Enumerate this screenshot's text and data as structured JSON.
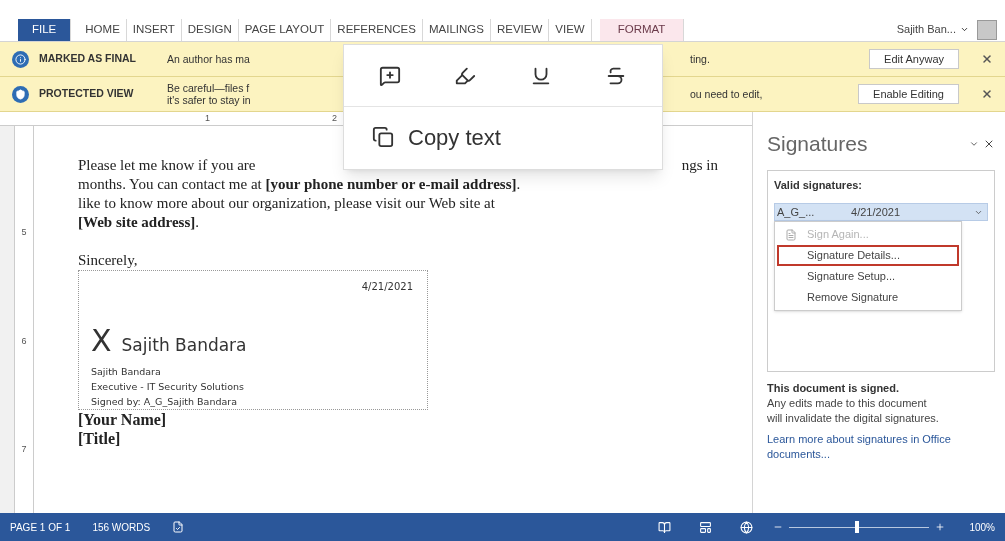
{
  "ribbon_tabs": [
    {
      "label": "FILE",
      "kind": "file",
      "selected": false
    },
    {
      "label": "HOME",
      "kind": "tab",
      "selected": false
    },
    {
      "label": "INSERT",
      "kind": "tab",
      "selected": false
    },
    {
      "label": "DESIGN",
      "kind": "tab",
      "selected": false
    },
    {
      "label": "PAGE LAYOUT",
      "kind": "tab",
      "selected": false
    },
    {
      "label": "REFERENCES",
      "kind": "tab",
      "selected": false
    },
    {
      "label": "MAILINGS",
      "kind": "tab",
      "selected": false
    },
    {
      "label": "REVIEW",
      "kind": "tab",
      "selected": false
    },
    {
      "label": "VIEW",
      "kind": "tab",
      "selected": false
    },
    {
      "label": "FORMAT",
      "kind": "contextual",
      "selected": false
    }
  ],
  "user": {
    "name": "Sajith Ban..."
  },
  "message_bars": [
    {
      "kind": "info",
      "title": "MARKED AS FINAL",
      "left_lines": [
        "An author has ma"
      ],
      "right_lines": [
        "ting."
      ],
      "button": "Edit Anyway"
    },
    {
      "kind": "shield",
      "title": "PROTECTED VIEW",
      "left_lines": [
        "Be careful—files f",
        "it's safer to stay in"
      ],
      "right_lines": [
        "ou need to edit,"
      ],
      "button": "Enable Editing"
    }
  ],
  "popup": {
    "action": "Copy text"
  },
  "ruler": {
    "marks": [
      "1",
      "2"
    ],
    "side_marks": [
      "5",
      "6",
      "7"
    ]
  },
  "document": {
    "first_line_left": "Please let me know if you are",
    "first_line_right": "ngs in",
    "lines": [
      "months. You can contact me at **[your phone number or e-mail address]**.",
      "like to know more about our organization, please visit our Web site at",
      "**[Web site address]**."
    ],
    "closing": "Sincerely,",
    "signature": {
      "date": "4/21/2021",
      "mark": "X",
      "name": "Sajith Bandara",
      "details": [
        "Sajith Bandara",
        "Executive - IT Security Solutions",
        "Signed by: A_G_Sajith Bandara"
      ]
    },
    "after": [
      "[Your Name]",
      "[Title]"
    ]
  },
  "pane": {
    "title": "Signatures",
    "section": "Valid signatures:",
    "signature": {
      "name": "A_G_...",
      "date": "4/21/2021"
    },
    "menu": [
      {
        "label": "Sign Again...",
        "disabled": true,
        "selected": false
      },
      {
        "label": "Signature Details...",
        "disabled": false,
        "selected": true
      },
      {
        "label": "Signature Setup...",
        "disabled": false,
        "selected": false
      },
      {
        "label": "Remove Signature",
        "disabled": false,
        "selected": false
      }
    ],
    "status_title": "This document is signed.",
    "status_text": "Any edits made to this document will invalidate the digital signatures.",
    "link": "Learn more about signatures in Office documents..."
  },
  "status_bar": {
    "page": "PAGE 1 OF 1",
    "words": "156 WORDS",
    "zoom": {
      "level": 0.5
    },
    "zoom_text": "100%"
  }
}
